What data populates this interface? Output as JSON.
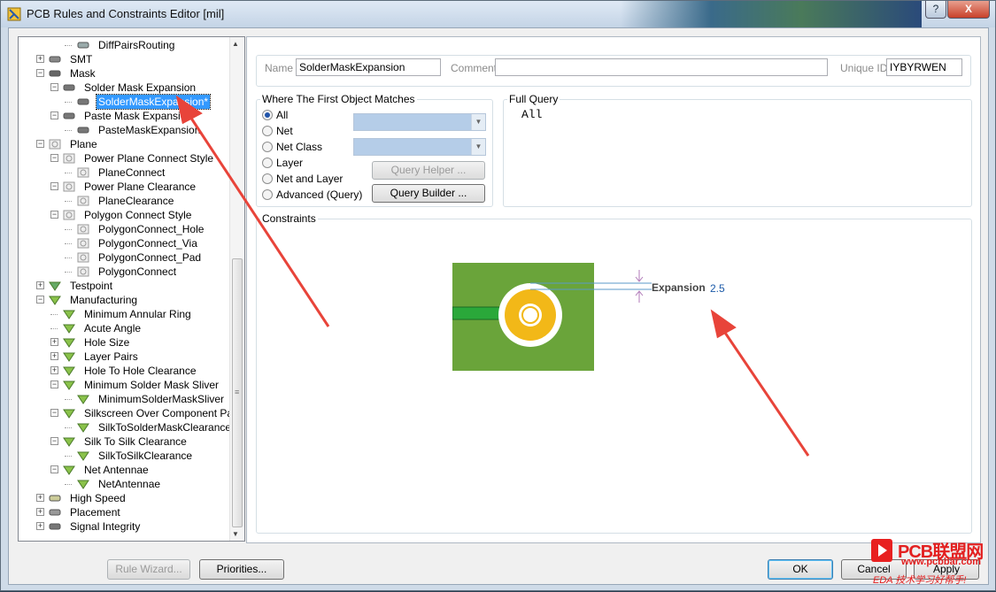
{
  "window": {
    "title": "PCB Rules and Constraints Editor [mil]",
    "help_label": "?",
    "close_label": "X"
  },
  "tree": {
    "items": [
      {
        "label": "DiffPairsRouting",
        "level": 3,
        "icon": "diffpair-rule-icon"
      },
      {
        "label": "SMT",
        "level": 1,
        "icon": "smt-icon",
        "expander": "+"
      },
      {
        "label": "Mask",
        "level": 1,
        "icon": "mask-icon",
        "expander": "-"
      },
      {
        "label": "Solder Mask Expansion",
        "level": 2,
        "icon": "mask-rule-icon",
        "expander": "-"
      },
      {
        "label": "SolderMaskExpansion*",
        "level": 3,
        "icon": "mask-rule-icon",
        "selected": true
      },
      {
        "label": "Paste Mask Expansion",
        "level": 2,
        "icon": "mask-rule-icon",
        "expander": "-"
      },
      {
        "label": "PasteMaskExpansion",
        "level": 3,
        "icon": "mask-rule-icon"
      },
      {
        "label": "Plane",
        "level": 1,
        "icon": "plane-icon",
        "expander": "-"
      },
      {
        "label": "Power Plane Connect Style",
        "level": 2,
        "icon": "plane-rule-icon",
        "expander": "-"
      },
      {
        "label": "PlaneConnect",
        "level": 3,
        "icon": "plane-rule-icon"
      },
      {
        "label": "Power Plane Clearance",
        "level": 2,
        "icon": "plane-rule-icon",
        "expander": "-"
      },
      {
        "label": "PlaneClearance",
        "level": 3,
        "icon": "plane-rule-icon"
      },
      {
        "label": "Polygon Connect Style",
        "level": 2,
        "icon": "plane-rule-icon",
        "expander": "-"
      },
      {
        "label": "PolygonConnect_Hole",
        "level": 3,
        "icon": "plane-rule-icon"
      },
      {
        "label": "PolygonConnect_Via",
        "level": 3,
        "icon": "plane-rule-icon"
      },
      {
        "label": "PolygonConnect_Pad",
        "level": 3,
        "icon": "plane-rule-icon"
      },
      {
        "label": "PolygonConnect",
        "level": 3,
        "icon": "plane-rule-icon"
      },
      {
        "label": "Testpoint",
        "level": 1,
        "icon": "testpoint-icon",
        "expander": "+"
      },
      {
        "label": "Manufacturing",
        "level": 1,
        "icon": "manufacturing-icon",
        "expander": "-"
      },
      {
        "label": "Minimum Annular Ring",
        "level": 2,
        "icon": "manufacturing-icon"
      },
      {
        "label": "Acute Angle",
        "level": 2,
        "icon": "manufacturing-icon"
      },
      {
        "label": "Hole Size",
        "level": 2,
        "icon": "manufacturing-icon",
        "expander": "+"
      },
      {
        "label": "Layer Pairs",
        "level": 2,
        "icon": "manufacturing-icon",
        "expander": "+"
      },
      {
        "label": "Hole To Hole Clearance",
        "level": 2,
        "icon": "manufacturing-icon",
        "expander": "+"
      },
      {
        "label": "Minimum Solder Mask Sliver",
        "level": 2,
        "icon": "manufacturing-icon",
        "expander": "-"
      },
      {
        "label": "MinimumSolderMaskSliver",
        "level": 3,
        "icon": "manufacturing-icon"
      },
      {
        "label": "Silkscreen Over Component Pads",
        "level": 2,
        "icon": "manufacturing-icon",
        "expander": "-"
      },
      {
        "label": "SilkToSolderMaskClearance",
        "level": 3,
        "icon": "manufacturing-icon"
      },
      {
        "label": "Silk To Silk Clearance",
        "level": 2,
        "icon": "manufacturing-icon",
        "expander": "-"
      },
      {
        "label": "SilkToSilkClearance",
        "level": 3,
        "icon": "manufacturing-icon"
      },
      {
        "label": "Net Antennae",
        "level": 2,
        "icon": "manufacturing-icon",
        "expander": "-"
      },
      {
        "label": "NetAntennae",
        "level": 3,
        "icon": "manufacturing-icon"
      },
      {
        "label": "High Speed",
        "level": 1,
        "icon": "high-speed-icon",
        "expander": "+"
      },
      {
        "label": "Placement",
        "level": 1,
        "icon": "placement-icon",
        "expander": "+"
      },
      {
        "label": "Signal Integrity",
        "level": 1,
        "icon": "signal-integrity-icon",
        "expander": "+"
      }
    ]
  },
  "rule": {
    "name_label": "Name",
    "name_value": "SolderMaskExpansion",
    "comment_label": "Comment",
    "comment_value": "",
    "uid_label": "Unique ID",
    "uid_value": "IYBYRWEN"
  },
  "first_object": {
    "title": "Where The First Object Matches",
    "options": [
      "All",
      "Net",
      "Net Class",
      "Layer",
      "Net and Layer",
      "Advanced (Query)"
    ],
    "selected": "All",
    "query_helper_label": "Query Helper ...",
    "query_builder_label": "Query Builder ..."
  },
  "full_query": {
    "title": "Full Query",
    "text": "All"
  },
  "constraints": {
    "title": "Constraints",
    "expansion_label": "Expansion",
    "expansion_value": "2.5"
  },
  "footer": {
    "rule_wizard_label": "Rule Wizard...",
    "priorities_label": "Priorities...",
    "ok_label": "OK",
    "cancel_label": "Cancel",
    "apply_label": "Apply"
  },
  "watermark": {
    "brand": "PCB联盟网",
    "url": "www.pcbbar.com",
    "slogan": "EDA 技术学习好帮手!"
  },
  "colors": {
    "board_green": "#6aa43a",
    "pad_gold": "#f2b818",
    "track_green": "#2aa83a",
    "selection_blue": "#3399ff",
    "annotation_red": "#e8443a"
  }
}
